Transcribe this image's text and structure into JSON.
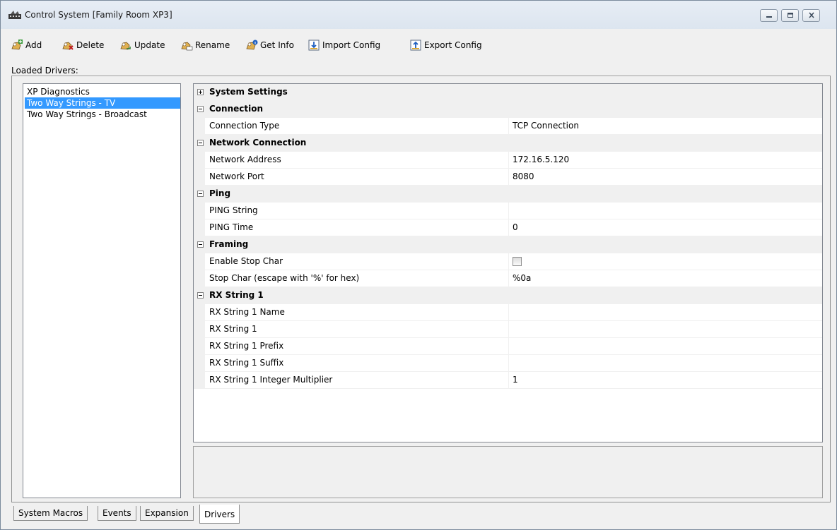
{
  "window": {
    "title": "Control System [Family Room XP3]"
  },
  "toolbar": {
    "items": [
      {
        "label": "Add",
        "icon": "add-driver-icon"
      },
      {
        "label": "Delete",
        "icon": "delete-driver-icon"
      },
      {
        "label": "Update",
        "icon": "update-driver-icon"
      },
      {
        "label": "Rename",
        "icon": "rename-driver-icon"
      },
      {
        "label": "Get Info",
        "icon": "info-driver-icon"
      },
      {
        "label": "Import Config",
        "icon": "import-icon"
      },
      {
        "label": "Export Config",
        "icon": "export-icon"
      }
    ]
  },
  "loaded_drivers": {
    "label": "Loaded Drivers:",
    "items": [
      {
        "label": "XP Diagnostics",
        "selected": false
      },
      {
        "label": "Two Way Strings - TV",
        "selected": true
      },
      {
        "label": "Two Way Strings - Broadcast",
        "selected": false
      }
    ]
  },
  "properties": {
    "system_settings": {
      "title": "System Settings",
      "expanded": false
    },
    "connection": {
      "title": "Connection",
      "connection_type": {
        "name": "Connection Type",
        "value": "TCP Connection"
      }
    },
    "network_connection": {
      "title": "Network Connection",
      "network_address": {
        "name": "Network Address",
        "value": "172.16.5.120"
      },
      "network_port": {
        "name": "Network Port",
        "value": "8080"
      }
    },
    "ping": {
      "title": "Ping",
      "ping_string": {
        "name": "PING String",
        "value": ""
      },
      "ping_time": {
        "name": "PING Time",
        "value": "0"
      }
    },
    "framing": {
      "title": "Framing",
      "enable_stop_char": {
        "name": "Enable Stop Char",
        "checked": false
      },
      "stop_char": {
        "name": "Stop Char (escape with '%' for hex)",
        "value": "%0a"
      }
    },
    "rx_string_1": {
      "title": "RX String 1",
      "name": {
        "name": "RX String 1 Name",
        "value": ""
      },
      "string": {
        "name": "RX String 1",
        "value": ""
      },
      "prefix": {
        "name": "RX String 1 Prefix",
        "value": ""
      },
      "suffix": {
        "name": "RX String 1 Suffix",
        "value": ""
      },
      "multiplier": {
        "name": "RX String 1 Integer Multiplier",
        "value": "1"
      }
    }
  },
  "tabs": [
    {
      "label": "System Macros",
      "active": false
    },
    {
      "label": "Events",
      "active": false
    },
    {
      "label": "Expansion",
      "active": false
    },
    {
      "label": "Drivers",
      "active": true
    }
  ]
}
